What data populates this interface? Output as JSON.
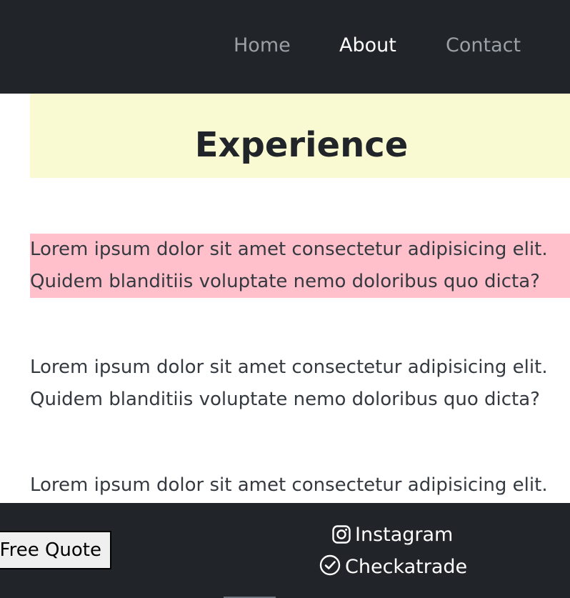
{
  "nav": {
    "items": [
      {
        "label": "Home",
        "active": false
      },
      {
        "label": "About",
        "active": true
      },
      {
        "label": "Contact",
        "active": false
      }
    ]
  },
  "main": {
    "heading": "Experience",
    "paragraphs": [
      {
        "line1": "Lorem ipsum dolor sit amet consectetur adipisicing elit.",
        "line2": "Quidem blanditiis voluptate nemo doloribus quo dicta?",
        "highlighted": true
      },
      {
        "line1": "Lorem ipsum dolor sit amet consectetur adipisicing elit.",
        "line2": "Quidem blanditiis voluptate nemo doloribus quo dicta?",
        "highlighted": false
      },
      {
        "line1": "Lorem ipsum dolor sit amet consectetur adipisicing elit.",
        "line2": "",
        "highlighted": false
      }
    ]
  },
  "footer": {
    "quote_button": "Free Quote",
    "social": [
      {
        "label": "Instagram",
        "icon": "instagram-icon"
      },
      {
        "label": "Checkatrade",
        "icon": "check-circle-icon"
      }
    ]
  },
  "colors": {
    "navbar_bg": "#212529",
    "heading_bg": "#f9f9d2",
    "highlight_bg": "#ffc0cb",
    "nav_inactive": "#9aa0a6",
    "nav_active": "#ffffff"
  }
}
